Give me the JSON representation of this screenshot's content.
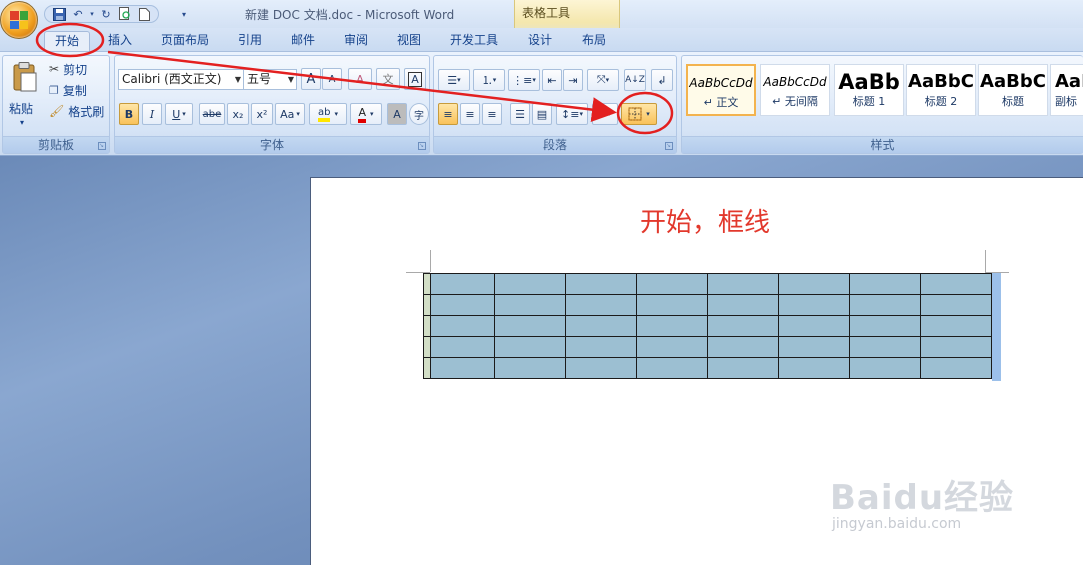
{
  "window": {
    "title": "新建 DOC 文档.doc - Microsoft Word",
    "context_tab_label": "表格工具"
  },
  "quick_access": {
    "icons": [
      "save-icon",
      "undo-icon",
      "redo-icon",
      "print-preview-icon",
      "new-document-icon",
      "customize-arrow-icon"
    ]
  },
  "tabs": [
    {
      "label": "开始",
      "active": true
    },
    {
      "label": "插入"
    },
    {
      "label": "页面布局"
    },
    {
      "label": "引用"
    },
    {
      "label": "邮件"
    },
    {
      "label": "审阅"
    },
    {
      "label": "视图"
    },
    {
      "label": "开发工具"
    },
    {
      "label": "设计"
    },
    {
      "label": "布局"
    }
  ],
  "clipboard": {
    "paste": "粘贴",
    "cut": "剪切",
    "copy": "复制",
    "format_painter": "格式刷",
    "group_label": "剪贴板"
  },
  "font": {
    "font_name": "Calibri (西文正文)",
    "font_size": "五号",
    "group_label": "字体",
    "buttons": {
      "grow": "A",
      "shrink": "A",
      "clear": "A",
      "phonetic": "文",
      "border_char": "A",
      "bold": "B",
      "italic": "I",
      "underline": "U",
      "strike": "abe",
      "subscript": "x₂",
      "superscript": "x²",
      "case": "Aa",
      "highlight": "ab",
      "font_color": "A",
      "shading_char": "A",
      "enclose": "字"
    }
  },
  "paragraph": {
    "group_label": "段落"
  },
  "styles": {
    "group_label": "样式",
    "items": [
      {
        "sample": "AaBbCcDd",
        "name": "↵ 正文"
      },
      {
        "sample": "AaBbCcDd",
        "name": "↵ 无间隔"
      },
      {
        "sample": "AaBb",
        "name": "标题 1"
      },
      {
        "sample": "AaBbC",
        "name": "标题 2"
      },
      {
        "sample": "AaBbC",
        "name": "标题"
      },
      {
        "sample": "AaB",
        "name": "副标"
      }
    ]
  },
  "document": {
    "annotation_text": "开始，框线",
    "table": {
      "rows": 5,
      "cols": 8
    }
  },
  "watermark": {
    "logo": "Baidu经验",
    "url": "jingyan.baidu.com"
  },
  "colors": {
    "annotation_red": "#e2382c",
    "table_fill": "#9cbfd2",
    "ribbon_blue": "#15428b"
  }
}
